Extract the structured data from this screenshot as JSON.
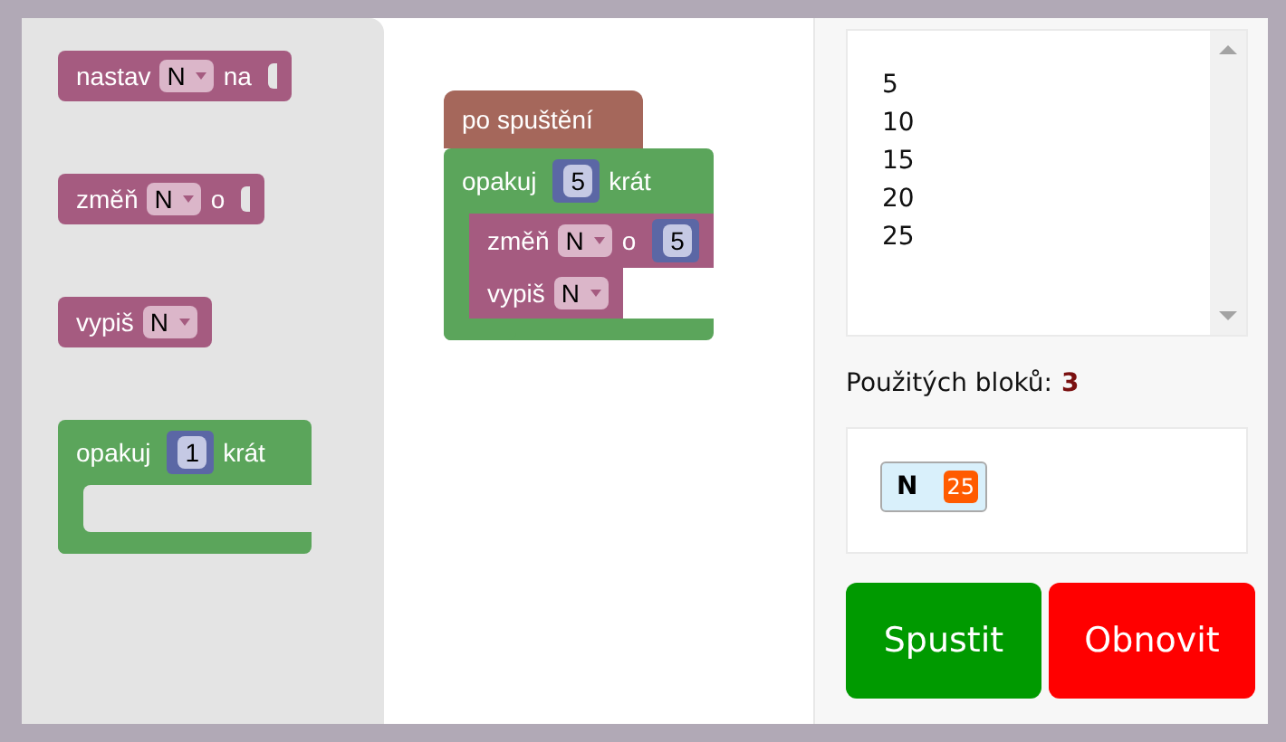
{
  "toolbox": {
    "blocks": [
      {
        "kind": "statement",
        "parts": [
          {
            "kind": "label",
            "text": "nastav"
          },
          {
            "kind": "dropdown",
            "text": "N"
          },
          {
            "kind": "label",
            "text": "na"
          },
          {
            "kind": "input"
          }
        ]
      },
      {
        "kind": "statement",
        "parts": [
          {
            "kind": "label",
            "text": "změň"
          },
          {
            "kind": "dropdown",
            "text": "N"
          },
          {
            "kind": "label",
            "text": "o"
          },
          {
            "kind": "input"
          }
        ]
      },
      {
        "kind": "statement",
        "parts": [
          {
            "kind": "label",
            "text": "vypiš"
          },
          {
            "kind": "dropdown",
            "text": "N"
          }
        ]
      },
      {
        "kind": "loop",
        "parts": [
          {
            "kind": "label",
            "text": "opakuj"
          },
          {
            "kind": "number",
            "text": "1"
          },
          {
            "kind": "label",
            "text": "krát"
          }
        ]
      }
    ]
  },
  "workspace": {
    "blocks": [
      {
        "kind": "event",
        "parts": [
          {
            "kind": "label",
            "text": "po spuštění"
          }
        ],
        "children": [
          {
            "kind": "loop",
            "parts": [
              {
                "kind": "label",
                "text": "opakuj"
              },
              {
                "kind": "number",
                "text": "5"
              },
              {
                "kind": "label",
                "text": "krát"
              }
            ],
            "children": [
              {
                "kind": "statement",
                "parts": [
                  {
                    "kind": "label",
                    "text": "změň"
                  },
                  {
                    "kind": "dropdown",
                    "text": "N"
                  },
                  {
                    "kind": "label",
                    "text": "o"
                  },
                  {
                    "kind": "number",
                    "text": "5"
                  }
                ]
              },
              {
                "kind": "statement",
                "parts": [
                  {
                    "kind": "label",
                    "text": "vypiš"
                  },
                  {
                    "kind": "dropdown",
                    "text": "N"
                  }
                ]
              }
            ]
          }
        ]
      }
    ]
  },
  "output": {
    "lines": [
      "5",
      "10",
      "15",
      "20",
      "25"
    ]
  },
  "block_count": {
    "label": "Použitých bloků:",
    "value": "3"
  },
  "variables": [
    {
      "name": "N",
      "value": "25"
    }
  ],
  "buttons": [
    {
      "label": "Spustit",
      "kind": "run"
    },
    {
      "label": "Obnovit",
      "kind": "reset"
    }
  ]
}
